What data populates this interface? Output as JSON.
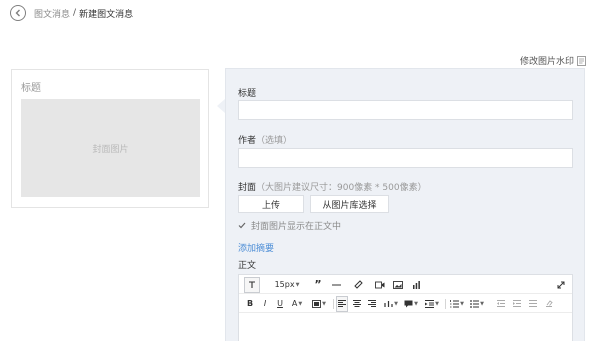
{
  "breadcrumb": {
    "parent": "图文消息",
    "separator": "/",
    "current": "新建图文消息"
  },
  "watermark_link": "修改图片水印",
  "preview": {
    "title": "标题",
    "cover_placeholder": "封面图片"
  },
  "form": {
    "title_label": "标题",
    "author_label": "作者",
    "author_hint": "（选填）",
    "cover_label": "封面",
    "cover_hint": "（大图片建议尺寸：900像素 * 500像素）",
    "upload_button": "上传",
    "library_button": "从图片库选择",
    "show_cover_label": "封面图片显示在正文中",
    "show_cover_checked": true,
    "add_summary_link": "添加摘要",
    "body_label": "正文"
  },
  "editor": {
    "font_size": "15px",
    "bold": "B",
    "italic": "I",
    "underline": "U",
    "font_color": "A"
  },
  "colors": {
    "accent_link": "#4c8dd6",
    "form_bg": "#eef1f6",
    "cover_bg": "#e6e6e6"
  }
}
